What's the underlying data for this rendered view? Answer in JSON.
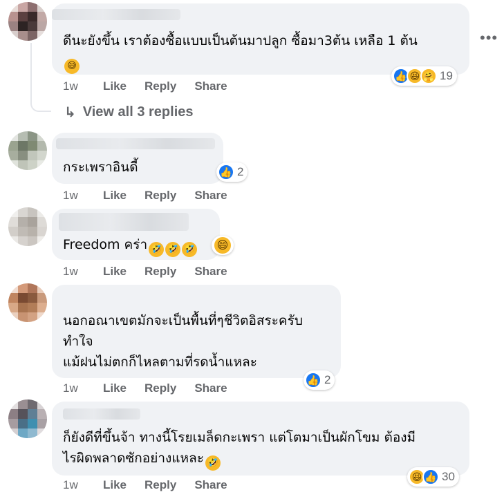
{
  "comments": [
    {
      "text_lines": [
        "ดีนะยังขึ้น เราต้องซื้อแบบเป็นต้นมาปลูก ซื้อมา3ต้น เหลือ 1 ต้น"
      ],
      "time": "1w",
      "reaction_count": "19",
      "reactions": [
        "like-icon",
        "haha-icon",
        "care-icon"
      ],
      "trailing_emoji": "😅",
      "avatar_colors": [
        "#e8dcd8",
        "#c9a6a4",
        "#8e6f70",
        "#d9cfcc",
        "#b8928f",
        "#5b4040",
        "#3a2a2a",
        "#c2a9a6",
        "#9b8282",
        "#2d2323",
        "#4a3a3a",
        "#bba7a5",
        "#d8cecc",
        "#a88e8c",
        "#7c6565",
        "#e6dedc"
      ]
    },
    {
      "text_lines": [
        "กระเพราอินดี้"
      ],
      "time": "1w",
      "reaction_count": "2",
      "reactions": [
        "like-icon"
      ],
      "avatar_colors": [
        "#e3e5e1",
        "#b6bdb2",
        "#8b9585",
        "#d4d8d0",
        "#9aa38f",
        "#6d7766",
        "#7f8a73",
        "#b3b9ad",
        "#a7ae9e",
        "#888f80",
        "#c1c6bb",
        "#d2d6cd",
        "#e0e3dc",
        "#bfc4b8",
        "#cdd2c7",
        "#e8eae5"
      ]
    },
    {
      "text_lines": [
        "Freedom คร่า"
      ],
      "time": "1w",
      "reactions": [
        "haha-icon"
      ],
      "avatar_colors": [
        "#f0efed",
        "#d9d6d2",
        "#c8c4bf",
        "#ecebe8",
        "#e0ddd9",
        "#b5b0aa",
        "#a9a39c",
        "#dedbd7",
        "#d2cec9",
        "#c0bbb5",
        "#b8b2ab",
        "#d9d5d1",
        "#ebe9e6",
        "#d6d2ce",
        "#cbc6c1",
        "#efedea"
      ]
    },
    {
      "text_lines": [
        "นอกอณาเขตมักจะเป็นพื้นที่ๆชีวิตอิสระครับ",
        "ทำใจ",
        "แม้ฝนไม่ตกก็ไหลตามที่รดน้ำแหละ"
      ],
      "time": "1w",
      "reaction_count": "2",
      "reactions": [
        "like-icon"
      ],
      "avatar_colors": [
        "#f1dcd0",
        "#d49a7a",
        "#b0765a",
        "#e8cbb9",
        "#c0845f",
        "#7a4a32",
        "#8a5a3e",
        "#c99a7c",
        "#d8a887",
        "#a8734f",
        "#b27d58",
        "#dcae8f",
        "#ead0bf",
        "#c89372",
        "#d3a283",
        "#efd9cb"
      ]
    },
    {
      "text_lines": [
        "ก็ยังดีที่ขึ้นจ้า ทางนี้โรยเมล็ดกะเพรา แต่โตมาเป็นผักโขม ต้องมี",
        "ไรผิดพลาดซักอย่างแหละ"
      ],
      "time": "1w",
      "reaction_count": "30",
      "reactions": [
        "haha-icon",
        "like-icon"
      ],
      "avatar_colors": [
        "#e3dfe0",
        "#9a8f93",
        "#6f6a70",
        "#d8d3d5",
        "#8c7f84",
        "#56525a",
        "#5f7f95",
        "#b9b0b3",
        "#a69ca0",
        "#4a6f87",
        "#3f8fb0",
        "#a8a0a4",
        "#d5d0d2",
        "#6ea8c5",
        "#8fb9d0",
        "#e0dcde"
      ]
    }
  ],
  "actions": {
    "like": "Like",
    "reply": "Reply",
    "share": "Share"
  },
  "view_replies": "View all 3 replies",
  "emoji_glyphs": {
    "rofl": "🤣",
    "grin": "😄",
    "sweat": "😅"
  }
}
